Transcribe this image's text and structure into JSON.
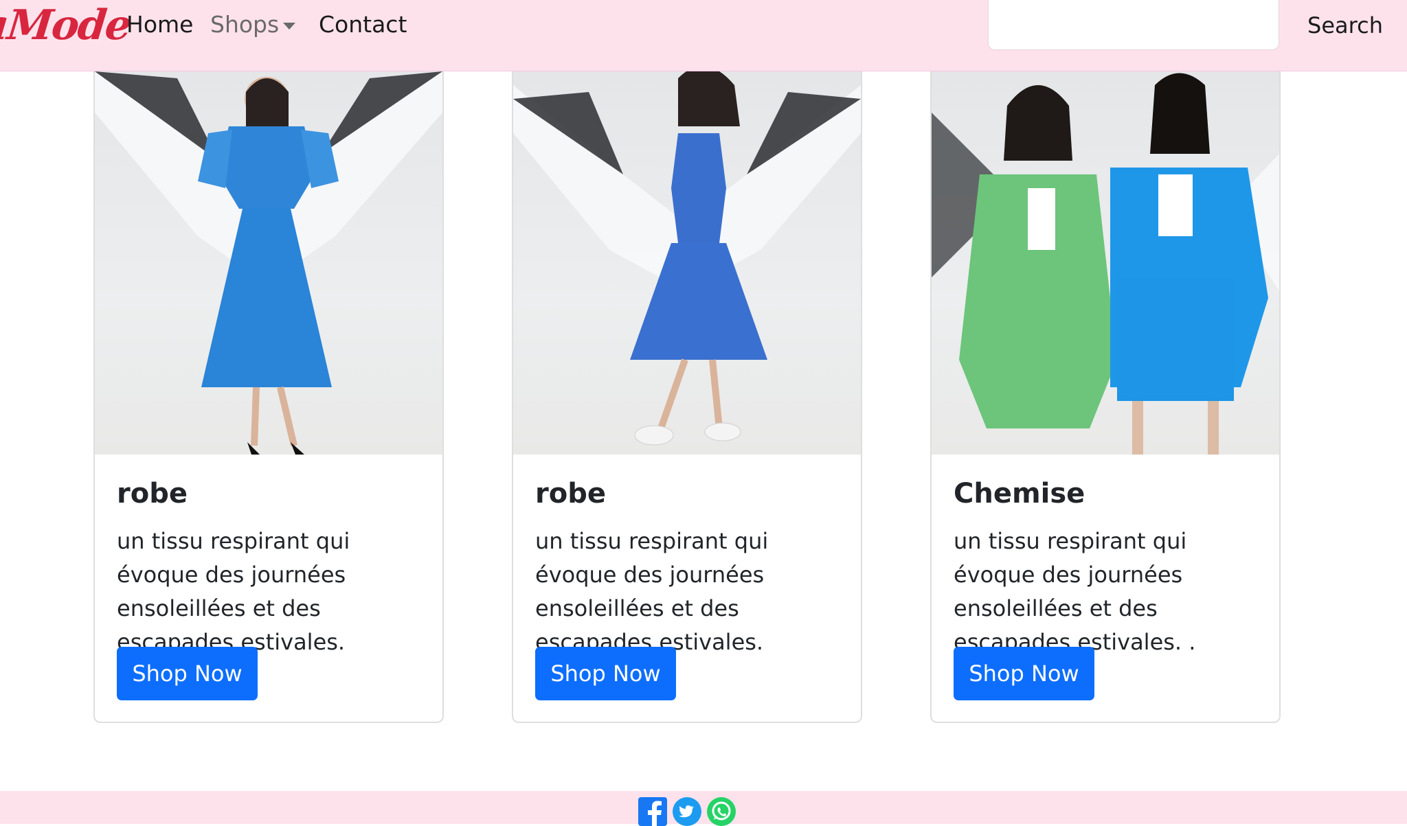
{
  "nav": {
    "brand": "aMode",
    "links": [
      "Home",
      "Shops",
      "Contact"
    ],
    "search_placeholder": "",
    "search_label": "Search"
  },
  "cards": [
    {
      "title": "robe",
      "text": "un tissu respirant qui évoque des journées ensoleillées et des escapades estivales.",
      "button": "Shop Now"
    },
    {
      "title": "robe",
      "text": "un tissu respirant qui évoque des journées ensoleillées et des escapades estivales.",
      "button": "Shop Now"
    },
    {
      "title": "Chemise",
      "text": "un tissu respirant qui évoque des journées ensoleillées et des escapades estivales. .",
      "button": "Shop Now"
    }
  ],
  "footer": {
    "icons": [
      "facebook-icon",
      "twitter-icon",
      "whatsapp-icon"
    ]
  },
  "colors": {
    "navbar_bg": "#fde2ec",
    "brand": "#d8263f",
    "primary_button": "#0d6efd",
    "facebook": "#1877f2",
    "twitter": "#1d9bf0",
    "whatsapp": "#25d366"
  }
}
